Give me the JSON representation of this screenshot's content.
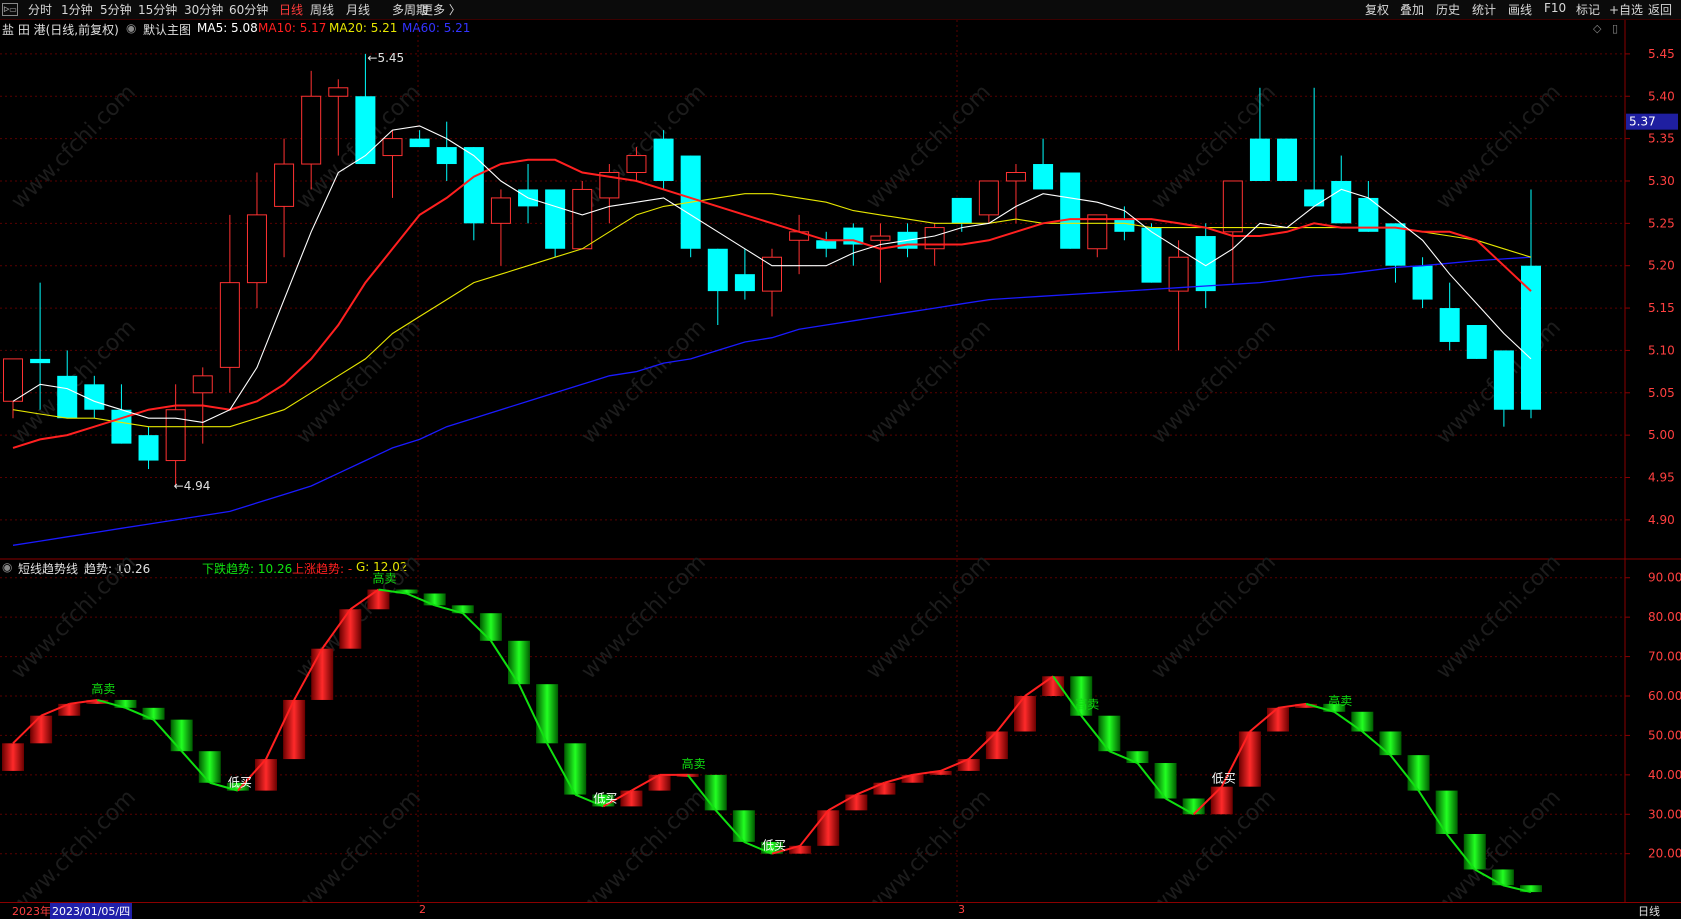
{
  "toolbar": {
    "corner_icon": "split-window-icon",
    "tabs": [
      "分时",
      "1分钟",
      "5分钟",
      "15分钟",
      "30分钟",
      "60分钟",
      "日线",
      "周线",
      "月线",
      "多周期",
      "更多 〉"
    ],
    "active_tab": "日线",
    "right_buttons": [
      "复权",
      "叠加",
      "历史",
      "统计",
      "画线",
      "F10",
      "标记",
      "+自选",
      "返回"
    ]
  },
  "main_panel": {
    "title": "盐 田 港(日线,前复权)",
    "template_label": "默认主图",
    "ma5_label": "MA5: 5.08",
    "ma10_label": "MA10: 5.17",
    "ma20_label": "MA20: 5.21",
    "ma60_label": "MA60: 5.21",
    "high_marker": "5.45",
    "low_marker": "4.94",
    "current_price_tag": "5.37",
    "colors": {
      "up": "#ff3232",
      "down": "#00ffff",
      "ma5": "#ffffff",
      "ma10": "#ff2020",
      "ma20": "#e6e600",
      "ma60": "#1a1aff"
    }
  },
  "sub_panel": {
    "title": "短线趋势线",
    "trend_label": "趋势: 10.26",
    "down_label": "下跌趋势: 10.26",
    "up_label": "上涨趋势: -",
    "g_label": "G: 12.02",
    "colors": {
      "up": "#ff2020",
      "down": "#10e010"
    }
  },
  "bottom_bar": {
    "year_label": "2023年",
    "cursor_date": "2023/01/05/四",
    "month_2": "2",
    "month_3": "3",
    "period_label": "日线"
  },
  "watermark": "www.cfchi.com",
  "chart_data": [
    {
      "type": "candlestick",
      "title": "盐 田 港(日线,前复权)",
      "y_ticks": [
        "5.45",
        "5.40",
        "5.35",
        "5.30",
        "5.25",
        "5.20",
        "5.15",
        "5.10",
        "5.05",
        "5.00",
        "4.95",
        "4.90"
      ],
      "ylim": [
        4.855,
        5.49
      ],
      "candles": [
        {
          "o": 5.04,
          "h": 5.09,
          "l": 5.02,
          "c": 5.09
        },
        {
          "o": 5.09,
          "h": 5.18,
          "l": 5.03,
          "c": 5.085
        },
        {
          "o": 5.07,
          "h": 5.1,
          "l": 5.02,
          "c": 5.02
        },
        {
          "o": 5.06,
          "h": 5.07,
          "l": 5.02,
          "c": 5.03
        },
        {
          "o": 5.03,
          "h": 5.06,
          "l": 4.99,
          "c": 4.99
        },
        {
          "o": 5.0,
          "h": 5.01,
          "l": 4.96,
          "c": 4.97
        },
        {
          "o": 4.97,
          "h": 5.06,
          "l": 4.94,
          "c": 5.03
        },
        {
          "o": 5.05,
          "h": 5.08,
          "l": 4.99,
          "c": 5.07
        },
        {
          "o": 5.08,
          "h": 5.26,
          "l": 5.05,
          "c": 5.18
        },
        {
          "o": 5.18,
          "h": 5.31,
          "l": 5.15,
          "c": 5.26
        },
        {
          "o": 5.27,
          "h": 5.35,
          "l": 5.21,
          "c": 5.32
        },
        {
          "o": 5.32,
          "h": 5.43,
          "l": 5.29,
          "c": 5.4
        },
        {
          "o": 5.4,
          "h": 5.42,
          "l": 5.33,
          "c": 5.41
        },
        {
          "o": 5.4,
          "h": 5.45,
          "l": 5.32,
          "c": 5.32
        },
        {
          "o": 5.33,
          "h": 5.36,
          "l": 5.28,
          "c": 5.35
        },
        {
          "o": 5.35,
          "h": 5.36,
          "l": 5.34,
          "c": 5.34
        },
        {
          "o": 5.34,
          "h": 5.37,
          "l": 5.3,
          "c": 5.32
        },
        {
          "o": 5.34,
          "h": 5.34,
          "l": 5.23,
          "c": 5.25
        },
        {
          "o": 5.25,
          "h": 5.29,
          "l": 5.2,
          "c": 5.28
        },
        {
          "o": 5.29,
          "h": 5.32,
          "l": 5.25,
          "c": 5.27
        },
        {
          "o": 5.29,
          "h": 5.29,
          "l": 5.21,
          "c": 5.22
        },
        {
          "o": 5.22,
          "h": 5.3,
          "l": 5.22,
          "c": 5.29
        },
        {
          "o": 5.28,
          "h": 5.32,
          "l": 5.25,
          "c": 5.31
        },
        {
          "o": 5.31,
          "h": 5.34,
          "l": 5.3,
          "c": 5.33
        },
        {
          "o": 5.35,
          "h": 5.36,
          "l": 5.29,
          "c": 5.3
        },
        {
          "o": 5.33,
          "h": 5.33,
          "l": 5.21,
          "c": 5.22
        },
        {
          "o": 5.22,
          "h": 5.22,
          "l": 5.13,
          "c": 5.17
        },
        {
          "o": 5.19,
          "h": 5.22,
          "l": 5.16,
          "c": 5.17
        },
        {
          "o": 5.17,
          "h": 5.22,
          "l": 5.14,
          "c": 5.21
        },
        {
          "o": 5.23,
          "h": 5.26,
          "l": 5.19,
          "c": 5.24
        },
        {
          "o": 5.23,
          "h": 5.24,
          "l": 5.21,
          "c": 5.22
        },
        {
          "o": 5.245,
          "h": 5.25,
          "l": 5.2,
          "c": 5.225
        },
        {
          "o": 5.23,
          "h": 5.25,
          "l": 5.18,
          "c": 5.235
        },
        {
          "o": 5.24,
          "h": 5.25,
          "l": 5.21,
          "c": 5.22
        },
        {
          "o": 5.22,
          "h": 5.25,
          "l": 5.2,
          "c": 5.245
        },
        {
          "o": 5.28,
          "h": 5.28,
          "l": 5.24,
          "c": 5.25
        },
        {
          "o": 5.26,
          "h": 5.3,
          "l": 5.25,
          "c": 5.3
        },
        {
          "o": 5.3,
          "h": 5.32,
          "l": 5.25,
          "c": 5.31
        },
        {
          "o": 5.32,
          "h": 5.35,
          "l": 5.29,
          "c": 5.29
        },
        {
          "o": 5.31,
          "h": 5.31,
          "l": 5.22,
          "c": 5.22
        },
        {
          "o": 5.22,
          "h": 5.26,
          "l": 5.21,
          "c": 5.26
        },
        {
          "o": 5.255,
          "h": 5.27,
          "l": 5.23,
          "c": 5.24
        },
        {
          "o": 5.245,
          "h": 5.25,
          "l": 5.18,
          "c": 5.18
        },
        {
          "o": 5.17,
          "h": 5.23,
          "l": 5.1,
          "c": 5.21
        },
        {
          "o": 5.235,
          "h": 5.25,
          "l": 5.15,
          "c": 5.17
        },
        {
          "o": 5.24,
          "h": 5.3,
          "l": 5.18,
          "c": 5.3
        },
        {
          "o": 5.35,
          "h": 5.41,
          "l": 5.3,
          "c": 5.3
        },
        {
          "o": 5.35,
          "h": 5.35,
          "l": 5.3,
          "c": 5.3
        },
        {
          "o": 5.29,
          "h": 5.41,
          "l": 5.27,
          "c": 5.27
        },
        {
          "o": 5.3,
          "h": 5.33,
          "l": 5.25,
          "c": 5.25
        },
        {
          "o": 5.28,
          "h": 5.3,
          "l": 5.24,
          "c": 5.24
        },
        {
          "o": 5.25,
          "h": 5.25,
          "l": 5.18,
          "c": 5.2
        },
        {
          "o": 5.2,
          "h": 5.21,
          "l": 5.15,
          "c": 5.16
        },
        {
          "o": 5.15,
          "h": 5.18,
          "l": 5.1,
          "c": 5.11
        },
        {
          "o": 5.13,
          "h": 5.13,
          "l": 5.09,
          "c": 5.09
        },
        {
          "o": 5.1,
          "h": 5.1,
          "l": 5.01,
          "c": 5.03
        },
        {
          "o": 5.2,
          "h": 5.29,
          "l": 5.02,
          "c": 5.03
        }
      ],
      "ma5": [
        5.04,
        5.06,
        5.055,
        5.04,
        5.03,
        5.02,
        5.02,
        5.015,
        5.03,
        5.08,
        5.16,
        5.24,
        5.31,
        5.33,
        5.36,
        5.365,
        5.35,
        5.33,
        5.3,
        5.28,
        5.27,
        5.26,
        5.27,
        5.275,
        5.28,
        5.26,
        5.24,
        5.22,
        5.2,
        5.2,
        5.2,
        5.215,
        5.225,
        5.23,
        5.235,
        5.245,
        5.25,
        5.27,
        5.285,
        5.28,
        5.275,
        5.265,
        5.24,
        5.22,
        5.2,
        5.22,
        5.25,
        5.245,
        5.27,
        5.29,
        5.28,
        5.255,
        5.23,
        5.19,
        5.155,
        5.12,
        5.09
      ],
      "ma10": [
        4.985,
        4.995,
        5.0,
        5.01,
        5.02,
        5.03,
        5.035,
        5.035,
        5.03,
        5.04,
        5.06,
        5.09,
        5.13,
        5.18,
        5.22,
        5.26,
        5.28,
        5.305,
        5.32,
        5.325,
        5.325,
        5.31,
        5.305,
        5.3,
        5.29,
        5.28,
        5.27,
        5.26,
        5.25,
        5.24,
        5.23,
        5.23,
        5.22,
        5.225,
        5.225,
        5.225,
        5.23,
        5.24,
        5.25,
        5.255,
        5.255,
        5.255,
        5.255,
        5.25,
        5.245,
        5.235,
        5.235,
        5.24,
        5.25,
        5.245,
        5.245,
        5.245,
        5.24,
        5.24,
        5.23,
        5.2,
        5.17
      ],
      "ma20": [
        5.03,
        5.025,
        5.02,
        5.02,
        5.015,
        5.01,
        5.01,
        5.01,
        5.01,
        5.02,
        5.03,
        5.05,
        5.07,
        5.09,
        5.12,
        5.14,
        5.16,
        5.18,
        5.19,
        5.2,
        5.21,
        5.22,
        5.24,
        5.26,
        5.27,
        5.275,
        5.28,
        5.285,
        5.285,
        5.28,
        5.275,
        5.265,
        5.26,
        5.255,
        5.25,
        5.25,
        5.25,
        5.255,
        5.25,
        5.25,
        5.25,
        5.25,
        5.245,
        5.245,
        5.245,
        5.245,
        5.245,
        5.245,
        5.245,
        5.245,
        5.245,
        5.245,
        5.24,
        5.235,
        5.23,
        5.22,
        5.21
      ],
      "ma60": [
        4.87,
        4.875,
        4.88,
        4.885,
        4.89,
        4.895,
        4.9,
        4.905,
        4.91,
        4.92,
        4.93,
        4.94,
        4.955,
        4.97,
        4.985,
        4.995,
        5.01,
        5.02,
        5.03,
        5.04,
        5.05,
        5.06,
        5.07,
        5.075,
        5.085,
        5.09,
        5.1,
        5.11,
        5.115,
        5.125,
        5.13,
        5.135,
        5.14,
        5.145,
        5.15,
        5.155,
        5.16,
        5.162,
        5.164,
        5.166,
        5.168,
        5.17,
        5.172,
        5.174,
        5.176,
        5.178,
        5.18,
        5.184,
        5.188,
        5.19,
        5.194,
        5.198,
        5.2,
        5.203,
        5.206,
        5.208,
        5.21
      ]
    },
    {
      "type": "line",
      "title": "短线趋势线",
      "y_ticks": [
        "90.00",
        "80.00",
        "70.00",
        "60.00",
        "50.00",
        "40.00",
        "30.00",
        "20.00"
      ],
      "ylim": [
        8.0,
        94.5
      ],
      "trend": [
        48,
        55,
        58,
        59,
        57,
        54,
        46,
        38,
        36,
        44,
        59,
        72,
        82,
        87,
        86,
        83,
        81,
        74,
        63,
        48,
        35,
        32,
        36,
        40,
        40,
        31,
        23,
        20,
        22,
        31,
        35,
        38,
        40,
        41,
        44,
        51,
        60,
        65,
        55,
        46,
        43,
        34,
        30,
        37,
        51,
        57,
        58,
        56,
        51,
        45,
        36,
        25,
        16,
        12,
        10.26
      ],
      "signals": [
        {
          "i": 3,
          "text": "高卖",
          "kind": "sell"
        },
        {
          "i": 8,
          "text": "低买",
          "kind": "buy"
        },
        {
          "i": 13,
          "text": "高卖",
          "kind": "sell"
        },
        {
          "i": 21,
          "text": "低买",
          "kind": "buy"
        },
        {
          "i": 24,
          "text": "高卖",
          "kind": "sell"
        },
        {
          "i": 27,
          "text": "低买",
          "kind": "buy"
        },
        {
          "i": 38,
          "text": "高卖",
          "kind": "sell"
        },
        {
          "i": 43,
          "text": "低买",
          "kind": "buy"
        },
        {
          "i": 47,
          "text": "高卖",
          "kind": "sell"
        }
      ]
    }
  ]
}
